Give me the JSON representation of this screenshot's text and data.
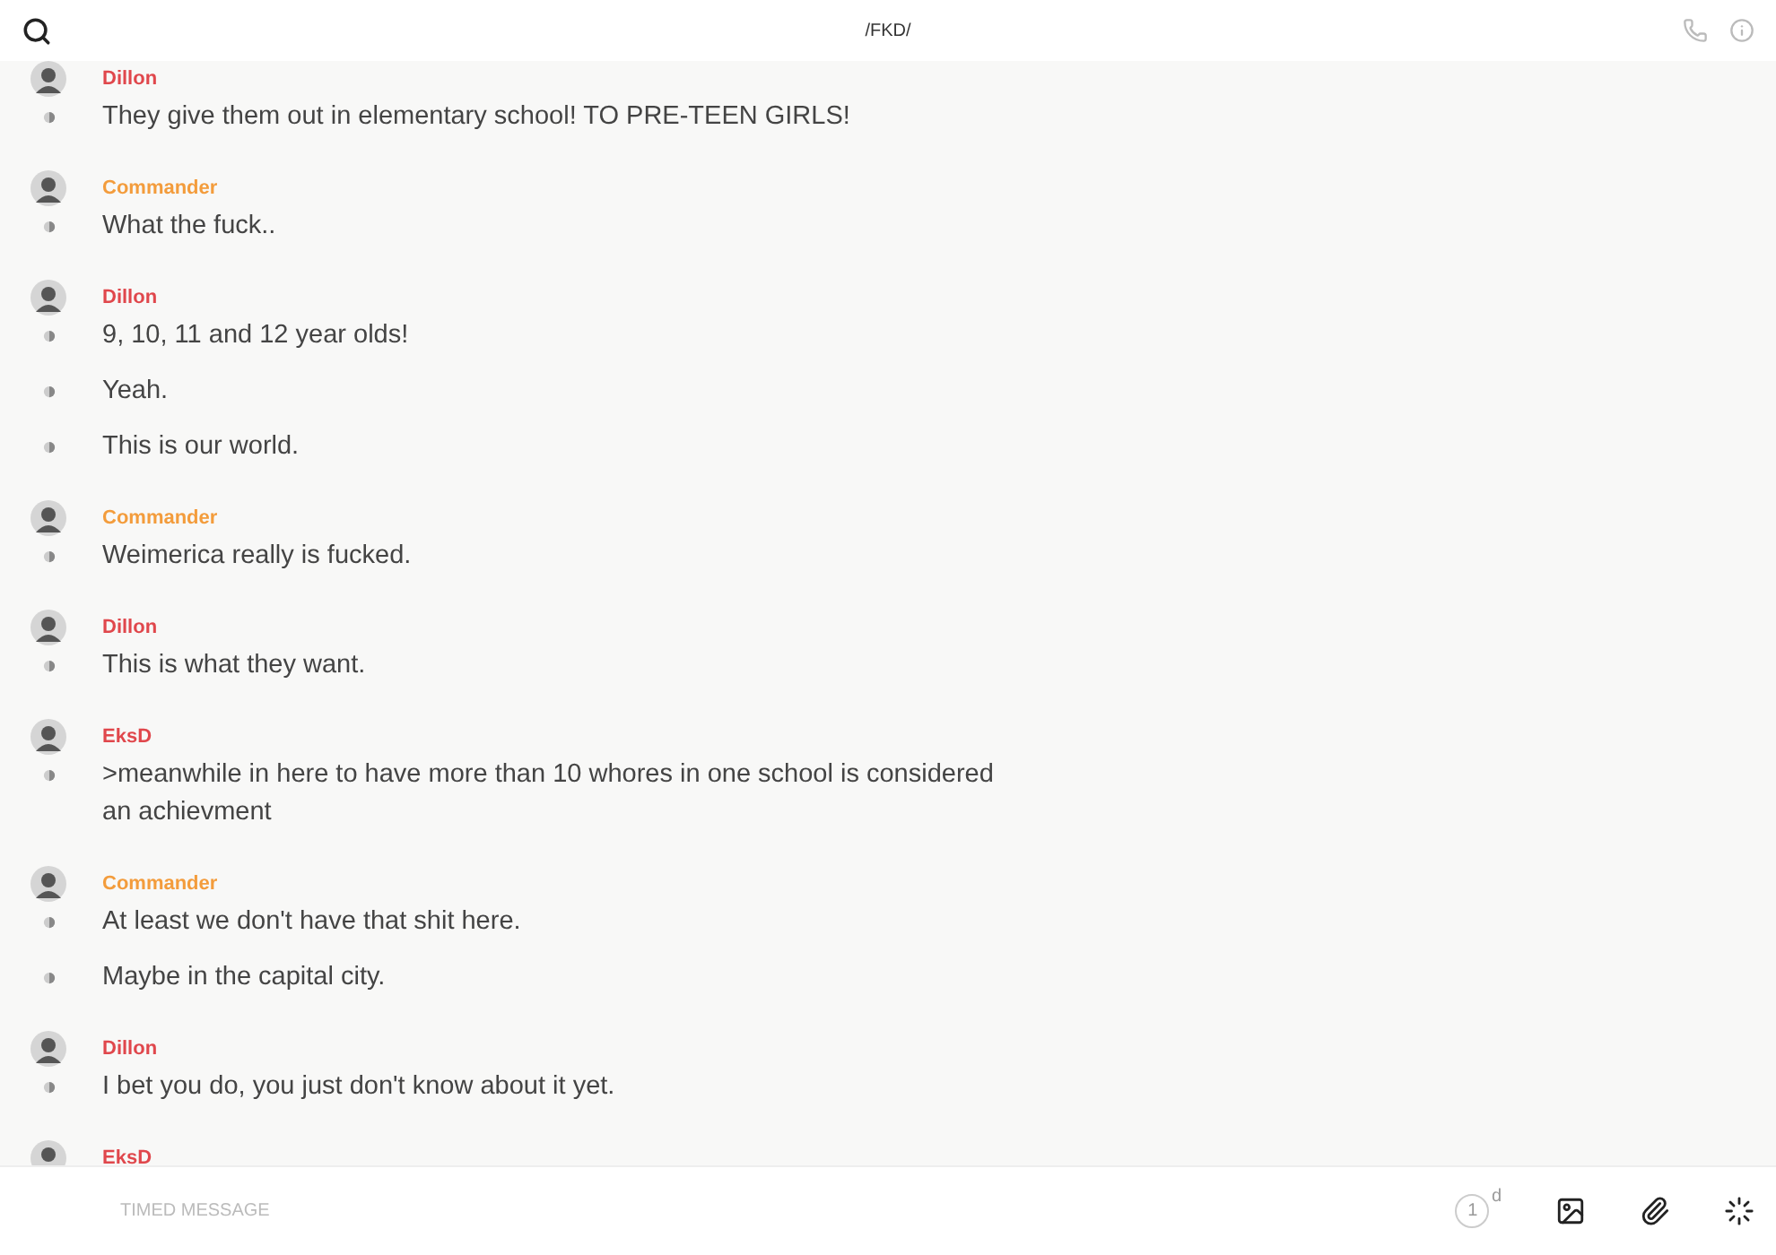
{
  "header": {
    "title": "/FKD/"
  },
  "groups": [
    {
      "author": "Dillon",
      "color": "#e0474c",
      "messages": [
        "They give them out in elementary school! TO PRE-TEEN GIRLS!"
      ]
    },
    {
      "author": "Commander",
      "color": "#f39c3c",
      "messages": [
        "What the fuck.."
      ]
    },
    {
      "author": "Dillon",
      "color": "#e0474c",
      "messages": [
        "9, 10, 11 and 12 year olds!",
        "Yeah.",
        "This is our world."
      ]
    },
    {
      "author": "Commander",
      "color": "#f39c3c",
      "messages": [
        "Weimerica really is fucked."
      ]
    },
    {
      "author": "Dillon",
      "color": "#e0474c",
      "messages": [
        "This is what they want."
      ]
    },
    {
      "author": "EksD",
      "color": "#e0474c",
      "messages": [
        ">meanwhile in here to have more than 10 whores in one school is considered an achievment"
      ]
    },
    {
      "author": "Commander",
      "color": "#f39c3c",
      "messages": [
        "At least we don't have that shit here.",
        "Maybe in the capital city."
      ]
    },
    {
      "author": "Dillon",
      "color": "#e0474c",
      "messages": [
        "I bet you do, you just don't know about it yet."
      ]
    },
    {
      "author": "EksD",
      "color": "#e0474c"
    }
  ],
  "composer": {
    "placeholder": "TIMED MESSAGE",
    "timer": "1",
    "timer_unit": "d"
  }
}
